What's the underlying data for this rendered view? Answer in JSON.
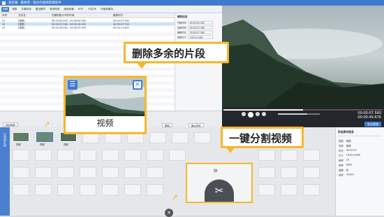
{
  "titlebar": {
    "app": "爱剪辑",
    "subtitle": "最易用 · 强大的视频剪辑软件"
  },
  "menu": [
    "视频",
    "音频",
    "字幕特效",
    "叠加素材",
    "转场特效",
    "画面风格",
    "MTV",
    "卡拉OK",
    "升级和服务"
  ],
  "clip_table": {
    "headers": [
      "序号",
      "文件名",
      "在最终影片中的时间",
      "截取时长"
    ],
    "rows": [
      [
        "01",
        "[视频]",
        "00:00:00.000 - 00:00:09.560",
        "00:00:07.560"
      ],
      [
        "02",
        "[视频]",
        "00:00:07.560 - 00:00:18.260",
        "00:00:07.700"
      ],
      [
        "03",
        "[视频]",
        "00:00:18.260 - 00:00:29.900",
        "00:00:11.640"
      ]
    ]
  },
  "side_info": {
    "title": "截取信息",
    "items": [
      {
        "k": "开始时间",
        "v": "00:00:00.000"
      },
      {
        "k": "结束时间",
        "v": "00:00:07.560"
      },
      {
        "k": "截取时长",
        "v": "00:00:07.560"
      },
      {
        "k": "视频尺寸",
        "v": "1920×1080"
      }
    ]
  },
  "buttons": {
    "add_video": "添加视频",
    "delete": "删除",
    "confirm": "确认修改"
  },
  "playback": {
    "time_current": "00:00:07.560",
    "time_total": "00:00:49.676",
    "fullscreen": "全屏",
    "export": "导出视频"
  },
  "timeline_label": "已添加片段",
  "thumbs": [
    {
      "label": "视频"
    },
    {
      "label": "视频"
    },
    {
      "label": "视频"
    }
  ],
  "props_panel": {
    "title": "所选素材信息",
    "items": [
      {
        "k": "类型",
        "v": "视频"
      },
      {
        "k": "名称",
        "v": "视频"
      },
      {
        "k": "时长",
        "v": "00:00:07"
      },
      {
        "k": "尺寸",
        "v": "1920×1080"
      },
      {
        "k": "帧率",
        "v": "25"
      },
      {
        "k": "码率",
        "v": "8000"
      },
      {
        "k": "音频",
        "v": "有"
      },
      {
        "k": "采样",
        "v": "44100"
      }
    ]
  },
  "callouts": {
    "delete_text": "删除多余的片段",
    "video_label": "视频",
    "split_text": "一键分割视频"
  },
  "colors": {
    "accent": "#3f7ad0",
    "callout": "#f7b72a"
  }
}
